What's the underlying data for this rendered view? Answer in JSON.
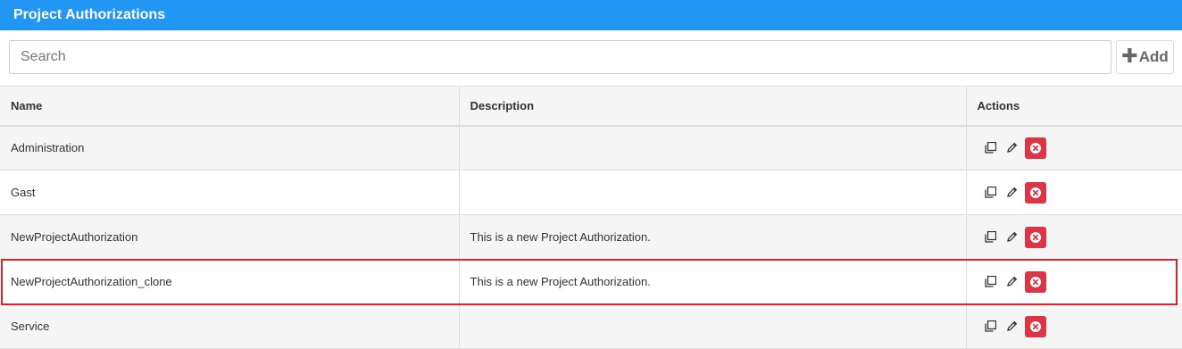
{
  "header": {
    "title": "Project Authorizations"
  },
  "search": {
    "placeholder": "Search",
    "value": ""
  },
  "toolbar": {
    "add_label": "Add"
  },
  "table": {
    "columns": [
      "Name",
      "Description",
      "Actions"
    ],
    "rows": [
      {
        "name": "Administration",
        "description": ""
      },
      {
        "name": "Gast",
        "description": ""
      },
      {
        "name": "NewProjectAuthorization",
        "description": "This is a new Project Authorization."
      },
      {
        "name": "NewProjectAuthorization_clone",
        "description": "This is a new Project Authorization.",
        "highlighted": true
      },
      {
        "name": "Service",
        "description": ""
      }
    ]
  },
  "icons": {
    "clone": "copy-icon",
    "edit": "pencil-icon",
    "delete": "close-circle-icon",
    "add": "plus-icon"
  },
  "colors": {
    "header": "#2196f3",
    "delete": "#dc3545",
    "highlight": "#d9232d"
  }
}
